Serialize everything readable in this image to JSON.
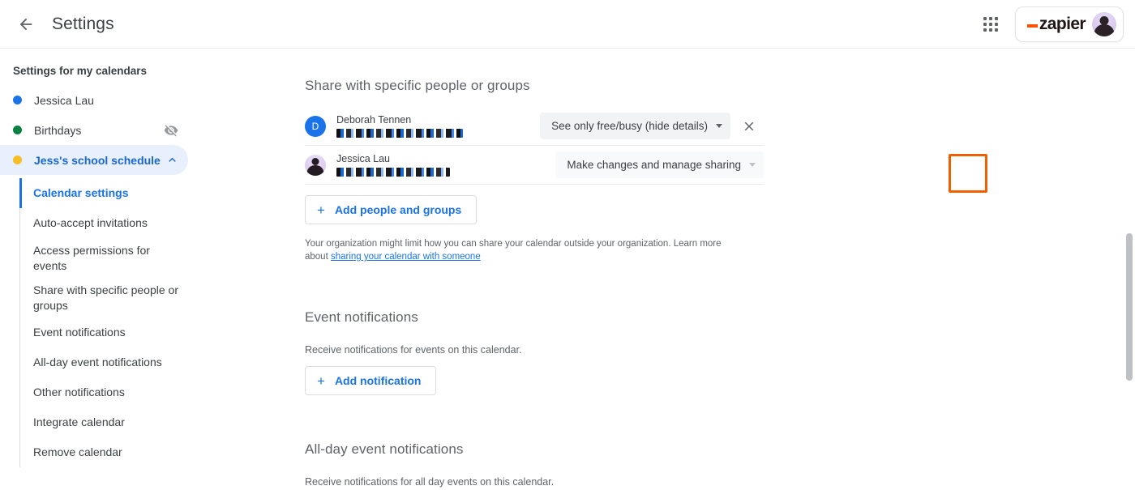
{
  "topbar": {
    "back_label": "back-arrow",
    "title": "Settings",
    "apps_label": "Google apps",
    "brand": {
      "prefix": "_",
      "word": "zapier"
    }
  },
  "sidebar": {
    "heading": "Settings for my calendars",
    "calendars": [
      {
        "name": "Jessica Lau",
        "color": "#1a73e8",
        "hidden": false,
        "selected": false,
        "expanded": false
      },
      {
        "name": "Birthdays",
        "color": "#0b8043",
        "hidden": true,
        "selected": false,
        "expanded": false
      },
      {
        "name": "Jess's school schedule",
        "color": "#f6bf26",
        "hidden": false,
        "selected": true,
        "expanded": true
      }
    ],
    "subitems": [
      {
        "label": "Calendar settings",
        "active": true
      },
      {
        "label": "Auto-accept invitations",
        "active": false
      },
      {
        "label": "Access permissions for events",
        "active": false
      },
      {
        "label": "Share with specific people or groups",
        "active": false
      },
      {
        "label": "Event notifications",
        "active": false
      },
      {
        "label": "All-day event notifications",
        "active": false
      },
      {
        "label": "Other notifications",
        "active": false
      },
      {
        "label": "Integrate calendar",
        "active": false
      },
      {
        "label": "Remove calendar",
        "active": false
      }
    ]
  },
  "main": {
    "share_section": {
      "title": "Share with specific people or groups",
      "rows": [
        {
          "name": "Deborah Tennen",
          "email_redacted": true,
          "avatar_type": "letter",
          "avatar_letter": "D",
          "avatar_color": "#1a73e8",
          "permission": "See only free/busy (hide details)",
          "removable": true
        },
        {
          "name": "Jessica Lau",
          "email_redacted": true,
          "avatar_type": "photo",
          "avatar_letter": "",
          "avatar_color": "#d9c9ee",
          "permission": "Make changes and manage sharing",
          "removable": false
        }
      ],
      "add_button": "Add people and groups",
      "help_text": "Your organization might limit how you can share your calendar outside your organization. Learn more about ",
      "help_link": "sharing your calendar with someone"
    },
    "event_notifications": {
      "title": "Event notifications",
      "description": "Receive notifications for events on this calendar.",
      "add_button": "Add notification"
    },
    "allday_notifications": {
      "title": "All-day event notifications",
      "description": "Receive notifications for all day events on this calendar."
    }
  },
  "annotation": {
    "color": "#ee6002",
    "target": "remove-person-button"
  }
}
